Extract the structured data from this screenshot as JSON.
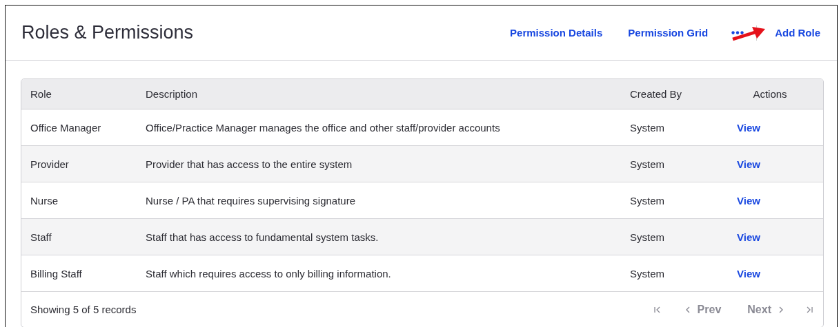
{
  "page": {
    "title": "Roles & Permissions"
  },
  "header_actions": [
    {
      "label": "Permission Details"
    },
    {
      "label": "Permission Grid"
    }
  ],
  "add_button": {
    "label": "Add Role"
  },
  "table": {
    "columns": [
      "Role",
      "Description",
      "Created By",
      "Actions"
    ],
    "rows": [
      {
        "role": "Office Manager",
        "description": "Office/Practice Manager manages the office and other staff/provider accounts",
        "created_by": "System",
        "action": "View"
      },
      {
        "role": "Provider",
        "description": "Provider that has access to the entire system",
        "created_by": "System",
        "action": "View"
      },
      {
        "role": "Nurse",
        "description": "Nurse / PA that requires supervising signature",
        "created_by": "System",
        "action": "View"
      },
      {
        "role": "Staff",
        "description": "Staff that has access to fundamental system tasks.",
        "created_by": "System",
        "action": "View"
      },
      {
        "role": "Billing Staff",
        "description": "Staff which requires access to only billing information.",
        "created_by": "System",
        "action": "View"
      }
    ]
  },
  "footer": {
    "summary": "Showing 5 of 5 records",
    "first_disabled": true,
    "prev": {
      "label": "Prev",
      "disabled": true
    },
    "next": {
      "label": "Next",
      "disabled": true
    },
    "last_disabled": true
  }
}
